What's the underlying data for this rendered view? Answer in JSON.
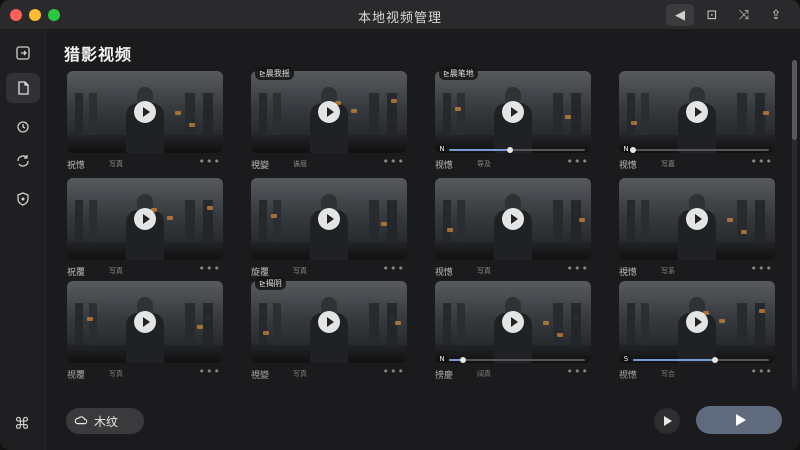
{
  "window": {
    "title": "本地视频管理"
  },
  "toolbar": {
    "buttons": [
      {
        "name": "volume-icon",
        "glyph": "◀",
        "active": true
      },
      {
        "name": "screen-icon",
        "glyph": "⊡",
        "active": false
      },
      {
        "name": "shuffle-icon",
        "glyph": "⤨",
        "active": false
      },
      {
        "name": "share-icon",
        "glyph": "⇪",
        "active": false
      }
    ]
  },
  "sidebar": {
    "items": [
      {
        "name": "sidebar-item-import",
        "icon": "import-icon",
        "active": false
      },
      {
        "name": "sidebar-item-files",
        "icon": "file-icon",
        "active": true
      },
      {
        "name": "sidebar-item-sync",
        "icon": "sync-icon",
        "active": false
      },
      {
        "name": "sidebar-item-rotate",
        "icon": "rotate-icon",
        "active": false
      },
      {
        "name": "sidebar-item-shield",
        "icon": "shield-icon",
        "active": false
      }
    ],
    "bottom_icon": "apps-icon"
  },
  "main": {
    "title": "猎影视频",
    "cards": [
      {
        "name": "祝憽",
        "sub": "写真",
        "tag": "",
        "progress": null
      },
      {
        "name": "視變",
        "sub": "诶屈",
        "tag": "⊵晨我揺",
        "progress": null
      },
      {
        "name": "视憽",
        "sub": "导及",
        "tag": "⊵晨笔地",
        "progress": {
          "chip": "N",
          "value": 0.45
        }
      },
      {
        "name": "视憽",
        "sub": "写嘉",
        "tag": "",
        "progress": {
          "chip": "N",
          "value": 0.0
        }
      },
      {
        "name": "祝覆",
        "sub": "写真",
        "tag": "",
        "progress": null
      },
      {
        "name": "旋覆",
        "sub": "写真",
        "tag": "",
        "progress": null
      },
      {
        "name": "视憽",
        "sub": "写真",
        "tag": "",
        "progress": null
      },
      {
        "name": "視憽",
        "sub": "写系",
        "tag": "",
        "progress": null
      },
      {
        "name": "视覆",
        "sub": "写真",
        "tag": "",
        "progress": null
      },
      {
        "name": "視變",
        "sub": "写真",
        "tag": "⊵揭阴",
        "progress": null
      },
      {
        "name": "搒慶",
        "sub": "阔真",
        "tag": "",
        "progress": {
          "chip": "N",
          "value": 0.1
        }
      },
      {
        "name": "视憽",
        "sub": "写会",
        "tag": "",
        "progress": {
          "chip": "S",
          "value": 0.6
        }
      }
    ]
  },
  "footer": {
    "pill_label": "木纹",
    "pill_icon": "cloud-sync-icon"
  },
  "colors": {
    "accent": "#7a9ad6",
    "primary_button": "#5f6a7d"
  }
}
